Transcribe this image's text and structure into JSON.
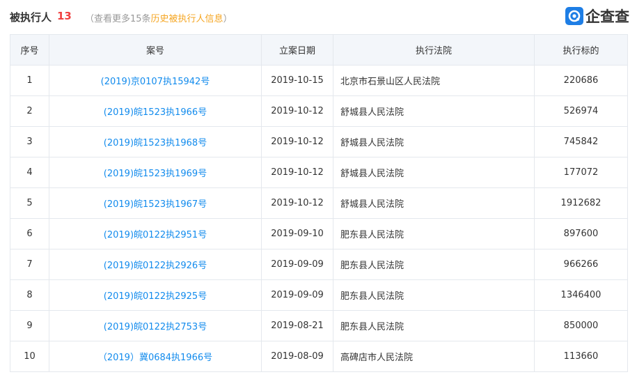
{
  "header": {
    "title": "被执行人",
    "count": "13",
    "sub_open": "（查看更多15条",
    "sub_link": "历史被执行人信息",
    "sub_close": "）",
    "logo_text": "企查查"
  },
  "colors": {
    "accent_blue": "#128bed",
    "count_red": "#f04040",
    "link_orange": "#f5a623",
    "header_bg": "#f3f6fa"
  },
  "table": {
    "columns": [
      "序号",
      "案号",
      "立案日期",
      "执行法院",
      "执行标的"
    ],
    "rows": [
      {
        "no": "1",
        "case": "(2019)京0107执15942号",
        "date": "2019-10-15",
        "court": "北京市石景山区人民法院",
        "amount": "220686"
      },
      {
        "no": "2",
        "case": "(2019)皖1523执1966号",
        "date": "2019-10-12",
        "court": "舒城县人民法院",
        "amount": "526974"
      },
      {
        "no": "3",
        "case": "(2019)皖1523执1968号",
        "date": "2019-10-12",
        "court": "舒城县人民法院",
        "amount": "745842"
      },
      {
        "no": "4",
        "case": "(2019)皖1523执1969号",
        "date": "2019-10-12",
        "court": "舒城县人民法院",
        "amount": "177072"
      },
      {
        "no": "5",
        "case": "(2019)皖1523执1967号",
        "date": "2019-10-12",
        "court": "舒城县人民法院",
        "amount": "1912682"
      },
      {
        "no": "6",
        "case": "(2019)皖0122执2951号",
        "date": "2019-09-10",
        "court": "肥东县人民法院",
        "amount": "897600"
      },
      {
        "no": "7",
        "case": "(2019)皖0122执2926号",
        "date": "2019-09-09",
        "court": "肥东县人民法院",
        "amount": "966266"
      },
      {
        "no": "8",
        "case": "(2019)皖0122执2925号",
        "date": "2019-09-09",
        "court": "肥东县人民法院",
        "amount": "1346400"
      },
      {
        "no": "9",
        "case": "(2019)皖0122执2753号",
        "date": "2019-08-21",
        "court": "肥东县人民法院",
        "amount": "850000"
      },
      {
        "no": "10",
        "case": "（2019）冀0684执1966号",
        "date": "2019-08-09",
        "court": "高碑店市人民法院",
        "amount": "113660"
      }
    ]
  }
}
